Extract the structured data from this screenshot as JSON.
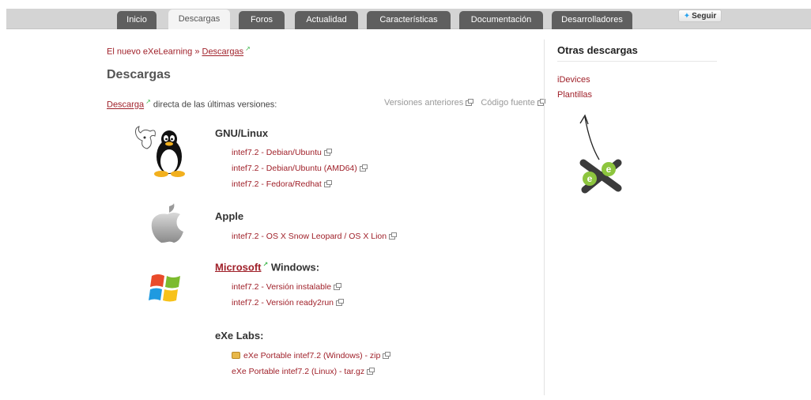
{
  "nav": {
    "tabs": [
      {
        "label": "Inicio"
      },
      {
        "label": "Descargas"
      },
      {
        "label": "Foros"
      },
      {
        "label": "Actualidad"
      },
      {
        "label": "Características"
      },
      {
        "label": "Documentación"
      },
      {
        "label": "Desarrolladores"
      }
    ],
    "follow_label": "Seguir"
  },
  "breadcrumb": {
    "home": "El nuevo eXeLearning",
    "separator": "»",
    "current": "Descargas"
  },
  "page": {
    "title": "Descargas",
    "intro_link": "Descarga",
    "intro_text": "directa de las últimas versiones:",
    "previous_versions": "Versiones anteriores",
    "source_code": "Código fuente"
  },
  "sections": {
    "linux": {
      "heading": "GNU/Linux",
      "items": [
        "intef7.2 - Debian/Ubuntu",
        "intef7.2 - Debian/Ubuntu (AMD64)",
        "intef7.2 - Fedora/Redhat"
      ]
    },
    "apple": {
      "heading": "Apple",
      "items": [
        "intef7.2 - OS X Snow Leopard / OS X Lion"
      ]
    },
    "windows": {
      "heading_link": "Microsoft",
      "heading_text": "Windows:",
      "items": [
        "intef7.2 - Versión instalable",
        "intef7.2 - Versión ready2run"
      ]
    },
    "labs": {
      "heading": "eXe Labs:",
      "items": [
        "eXe Portable intef7.2 (Windows) - zip",
        "eXe Portable intef7.2 (Linux) - tar.gz"
      ]
    }
  },
  "sidebar": {
    "title": "Otras descargas",
    "links": [
      "iDevices",
      "Plantillas"
    ],
    "logo_letter": "e"
  },
  "colors": {
    "link": "#a0212a",
    "tab_bg": "#5f5f5f",
    "tab_active_bg": "#f4f4f4",
    "external_icon": "#3bb54a"
  }
}
